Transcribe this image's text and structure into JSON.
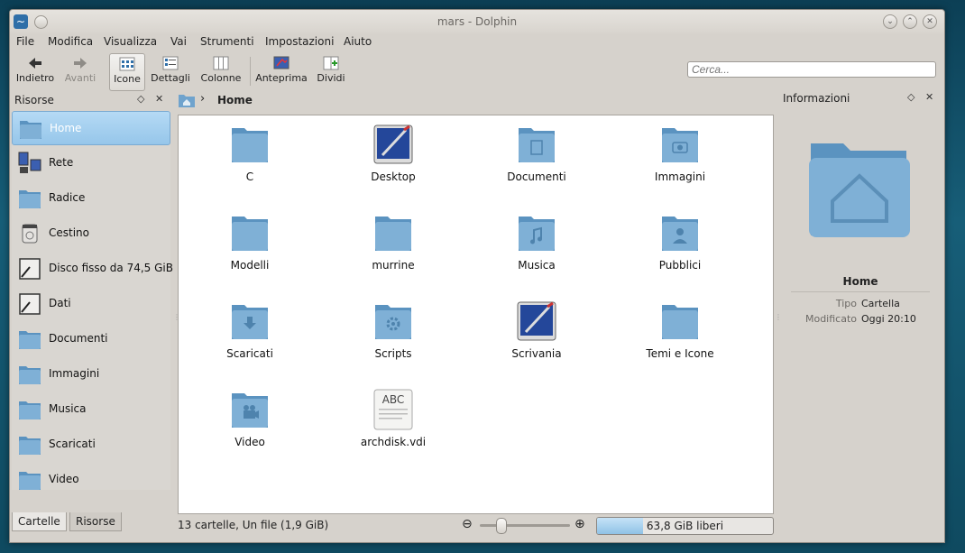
{
  "window": {
    "title": "mars - Dolphin"
  },
  "menubar": [
    "File",
    "Modifica",
    "Visualizza",
    "Vai",
    "Strumenti",
    "Impostazioni",
    "Aiuto"
  ],
  "toolbar": {
    "back": "Indietro",
    "forward": "Avanti",
    "icons_view": "Icone",
    "details_view": "Dettagli",
    "columns_view": "Colonne",
    "preview": "Anteprima",
    "split": "Dividi",
    "search_placeholder": "Cerca..."
  },
  "places_panel": {
    "title": "Risorse",
    "items": [
      {
        "label": "Home",
        "selected": true
      },
      {
        "label": "Rete"
      },
      {
        "label": "Radice"
      },
      {
        "label": "Cestino"
      },
      {
        "label": "Disco fisso da 74,5 GiB"
      },
      {
        "label": "Dati"
      },
      {
        "label": "Documenti"
      },
      {
        "label": "Immagini"
      },
      {
        "label": "Musica"
      },
      {
        "label": "Scaricati"
      },
      {
        "label": "Video"
      }
    ],
    "tabs": [
      "Cartelle",
      "Risorse"
    ]
  },
  "breadcrumb": {
    "current": "Home"
  },
  "files": [
    {
      "name": "C",
      "icon": "folder"
    },
    {
      "name": "Desktop",
      "icon": "desktop"
    },
    {
      "name": "Documenti",
      "icon": "folder-documents"
    },
    {
      "name": "Immagini",
      "icon": "folder-images"
    },
    {
      "name": "Modelli",
      "icon": "folder"
    },
    {
      "name": "murrine",
      "icon": "folder"
    },
    {
      "name": "Musica",
      "icon": "folder-music"
    },
    {
      "name": "Pubblici",
      "icon": "folder-public"
    },
    {
      "name": "Scaricati",
      "icon": "folder-downloads"
    },
    {
      "name": "Scripts",
      "icon": "folder-scripts"
    },
    {
      "name": "Scrivania",
      "icon": "desktop"
    },
    {
      "name": "Temi e Icone",
      "icon": "folder"
    },
    {
      "name": "Video",
      "icon": "folder-video"
    },
    {
      "name": "archdisk.vdi",
      "icon": "text-file"
    }
  ],
  "text_file_icon_label": "ABC",
  "status": {
    "summary": "13 cartelle, Un file (1,9 GiB)",
    "free_space": "63,8 GiB liberi",
    "used_fraction": 0.26,
    "zoom_level_fraction": 0.2
  },
  "info_panel": {
    "title": "Informazioni",
    "name": "Home",
    "type_key": "Tipo",
    "type_value": "Cartella",
    "modified_key": "Modificato",
    "modified_value": "Oggi 20:10"
  },
  "colors": {
    "folder": "#7fb0d6",
    "folder_dark": "#5b93c0",
    "selection": "#96c6ea"
  }
}
